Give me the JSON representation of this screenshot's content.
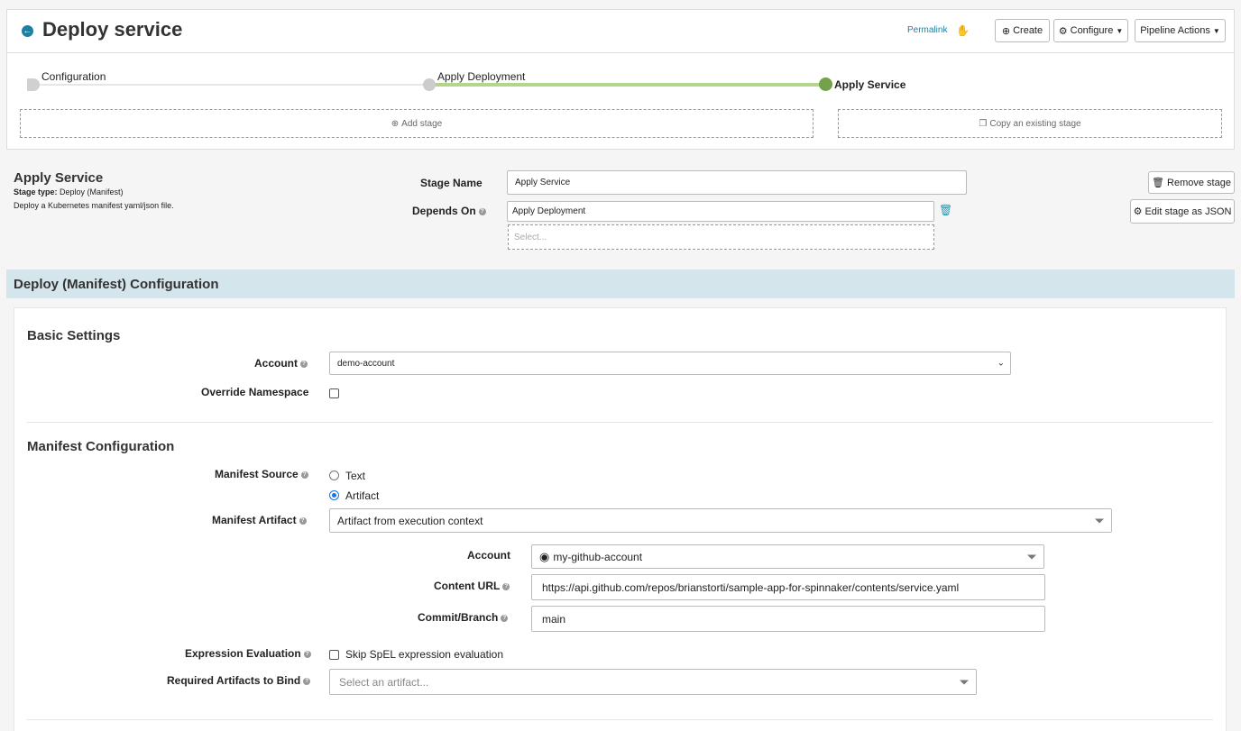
{
  "header": {
    "title": "Deploy service",
    "permalink": "Permalink",
    "create_label": "Create",
    "configure_label": "Configure",
    "actions_label": "Pipeline Actions"
  },
  "graph": {
    "stages": [
      "Configuration",
      "Apply Deployment",
      "Apply Service"
    ],
    "add_stage": "Add stage",
    "copy_stage": "Copy an existing stage"
  },
  "stage": {
    "title": "Apply Service",
    "type_label": "Stage type:",
    "type_value": "Deploy (Manifest)",
    "description": "Deploy a Kubernetes manifest yaml/json file.",
    "name_label": "Stage Name",
    "name_value": "Apply Service",
    "depends_label": "Depends On",
    "depends_value": "Apply Deployment",
    "depends_placeholder": "Select...",
    "remove_label": "Remove stage",
    "edit_json_label": "Edit stage as JSON"
  },
  "config": {
    "section_title": "Deploy (Manifest) Configuration",
    "basic_title": "Basic Settings",
    "account_label": "Account",
    "account_value": "demo-account",
    "override_ns_label": "Override Namespace",
    "manifest_title": "Manifest Configuration",
    "source_label": "Manifest Source",
    "source_text": "Text",
    "source_artifact": "Artifact",
    "artifact_label": "Manifest Artifact",
    "artifact_value": "Artifact from execution context",
    "gh_account_label": "Account",
    "gh_account_value": "my-github-account",
    "content_url_label": "Content URL",
    "content_url_value": "https://api.github.com/repos/brianstorti/sample-app-for-spinnaker/contents/service.yaml",
    "commit_label": "Commit/Branch",
    "commit_value": "main",
    "expr_label": "Expression Evaluation",
    "expr_option": "Skip SpEL expression evaluation",
    "required_label": "Required Artifacts to Bind",
    "required_placeholder": "Select an artifact..."
  }
}
